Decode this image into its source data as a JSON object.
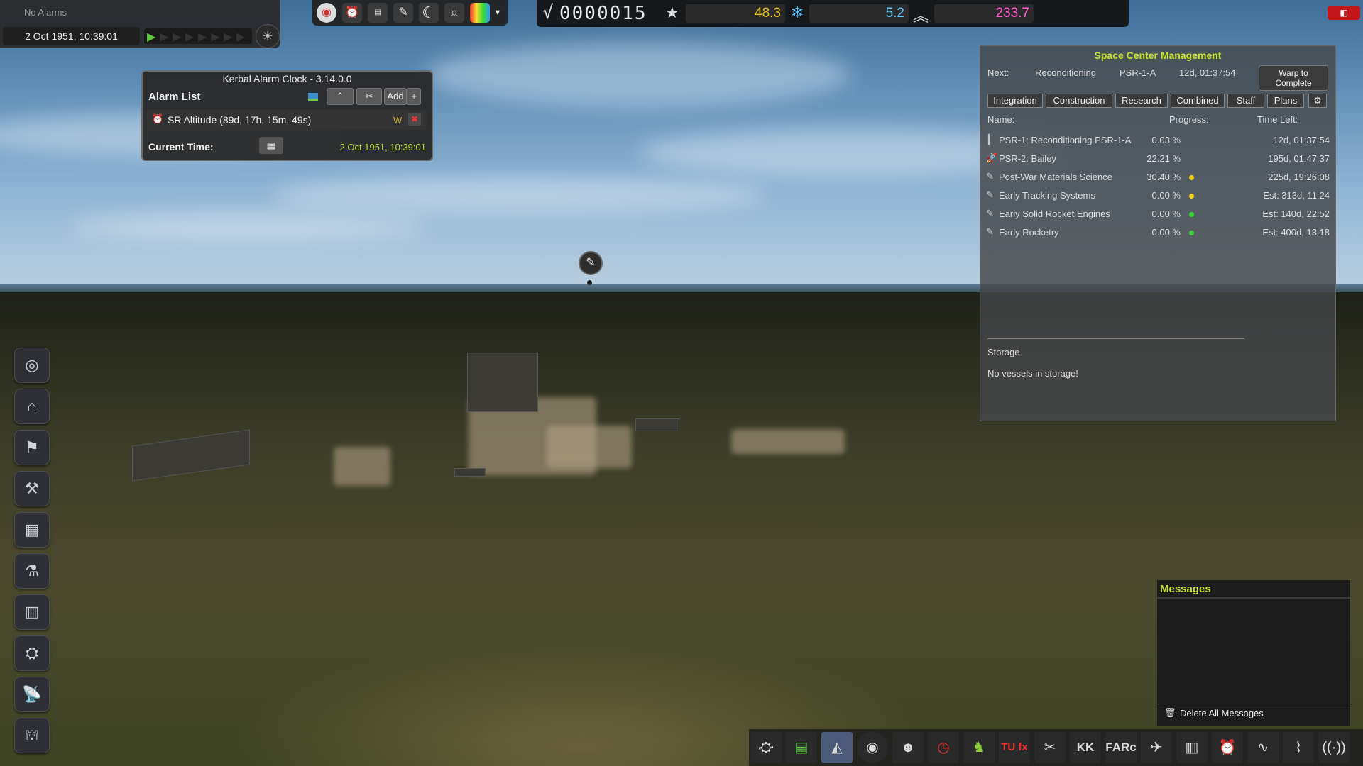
{
  "top_left": {
    "alarms_label": "No Alarms",
    "datetime": "2 Oct 1951, 10:39:01"
  },
  "top_icons": [
    "stock-app-icon",
    "alarm-clock-icon",
    "calendar-icon",
    "pen-icon",
    "moon-icon",
    "sun-settings-icon",
    "rainbow-icon",
    "dropdown-caret-icon"
  ],
  "resources": {
    "funds_symbol": "√",
    "funds": "0000015",
    "reputation": "48.3",
    "reputation_color": "#e8c21c",
    "science": "5.2",
    "science_color": "#5ec6ff",
    "confidence": "233.7",
    "confidence_color": "#ff5ad1"
  },
  "kac": {
    "title": "Kerbal Alarm Clock - 3.14.0.0",
    "header": "Alarm List",
    "add_label": "Add",
    "plus_label": "+",
    "alarm_text": "SR Altitude (89d, 17h, 15m, 49s)",
    "alarm_flag": "W",
    "current_time_label": "Current Time:",
    "current_time": "2 Oct 1951, 10:39:01"
  },
  "scm": {
    "title": "Space Center Management",
    "next_label": "Next:",
    "next_task": "Reconditioning",
    "next_target": "PSR-1-A",
    "next_time": "12d, 01:37:54",
    "warp_line1": "Warp to",
    "warp_line2": "Complete",
    "tabs": [
      "Integration",
      "Construction",
      "Research",
      "Combined",
      "Staff",
      "Plans"
    ],
    "col_name": "Name:",
    "col_progress": "Progress:",
    "col_time": "Time Left:",
    "rows": [
      {
        "icon": "launchpad-icon",
        "name": "PSR-1: Reconditioning PSR-1-A",
        "progress": "0.03 %",
        "dot": "",
        "time": "12d, 01:37:54"
      },
      {
        "icon": "rocket-icon",
        "name": "PSR-2: Bailey",
        "progress": "22.21 %",
        "dot": "",
        "time": "195d, 01:47:37"
      },
      {
        "icon": "research-icon",
        "name": "Post-War Materials Science",
        "progress": "30.40 %",
        "dot": "#f2d21f",
        "time": "225d, 19:26:08"
      },
      {
        "icon": "research-icon",
        "name": "Early Tracking Systems",
        "progress": "0.00 %",
        "dot": "#f2d21f",
        "time": "Est: 313d, 11:24"
      },
      {
        "icon": "research-icon",
        "name": "Early Solid Rocket Engines",
        "progress": "0.00 %",
        "dot": "#3ed43e",
        "time": "Est: 140d, 22:52"
      },
      {
        "icon": "research-icon",
        "name": "Early Rocketry",
        "progress": "0.00 %",
        "dot": "#3ed43e",
        "time": "Est: 400d, 13:18"
      }
    ],
    "storage_label": "Storage",
    "no_storage": "No vessels in storage!"
  },
  "messages": {
    "title": "Messages",
    "delete_all": "Delete All Messages"
  },
  "left_bar": [
    "mission-control-icon",
    "astronaut-complex-icon",
    "administration-icon",
    "vehicle-assembly-icon",
    "hangar-icon",
    "research-lab-icon",
    "runway-icon",
    "launchpad-icon",
    "tracking-station-icon",
    "vab-alt-icon"
  ],
  "bottom_bar": [
    "rocket-app-icon",
    "kerbal-construction-icon",
    "scenery-icon",
    "rp1-icon",
    "kerbal-face-icon",
    "timer-icon",
    "alien-icon",
    "tufx-icon",
    "tools-icon",
    "kk-icon",
    "farc-icon",
    "map-pin-icon",
    "clipboard-icon",
    "alarm-icon",
    "graph-icon",
    "antenna-graph-icon",
    "signal-icon"
  ],
  "bottom_labels": {
    "farc": "FARc",
    "kk": "KK",
    "tufx": "TU fx"
  }
}
